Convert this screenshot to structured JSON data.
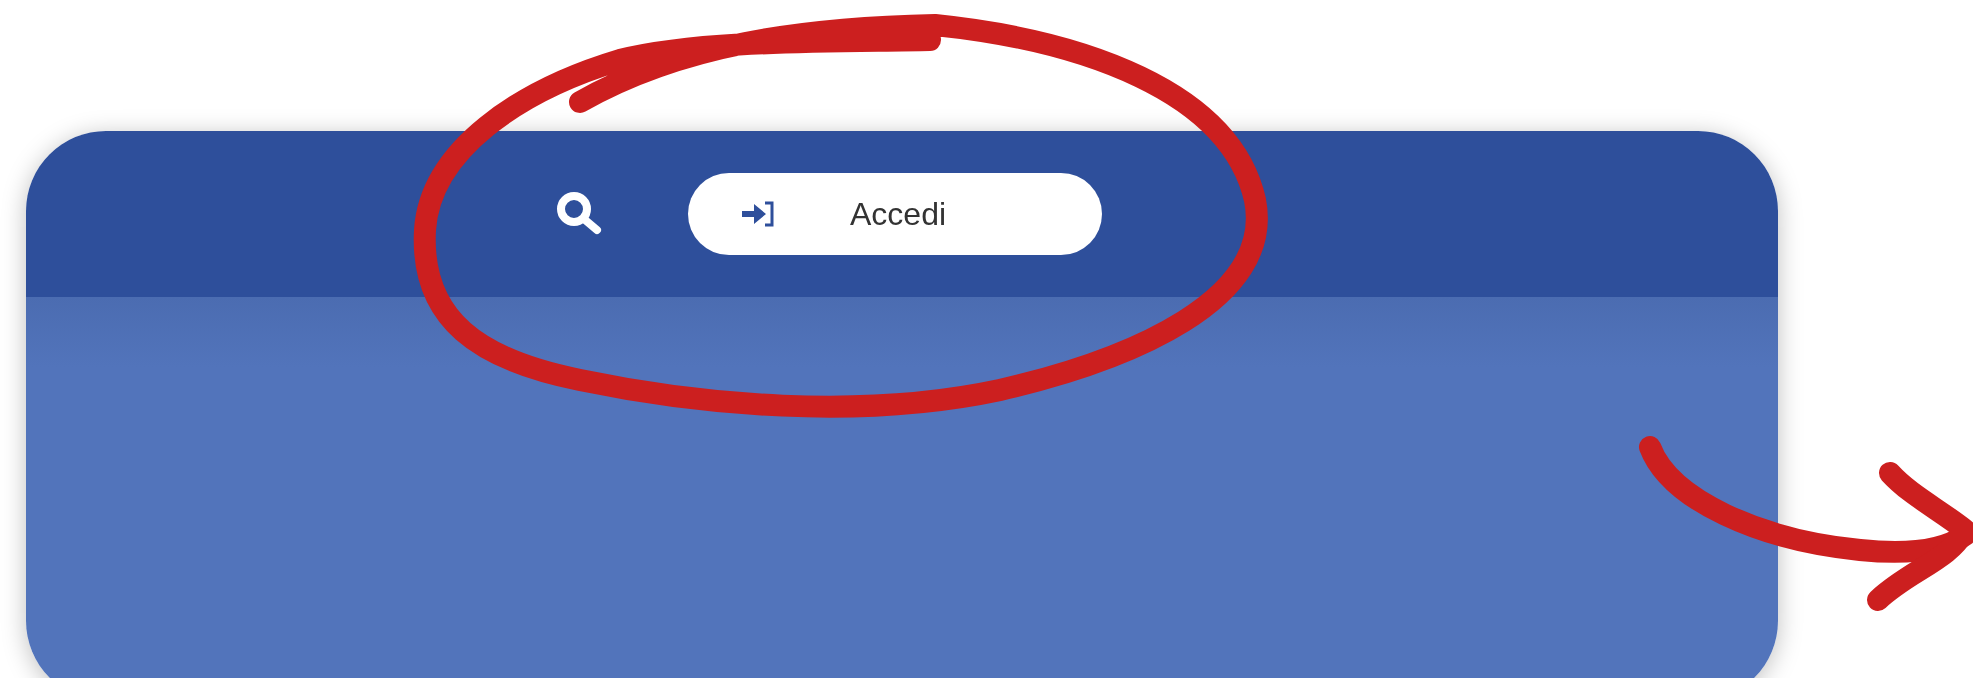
{
  "header": {
    "login_button": {
      "label": "Accedi"
    }
  }
}
